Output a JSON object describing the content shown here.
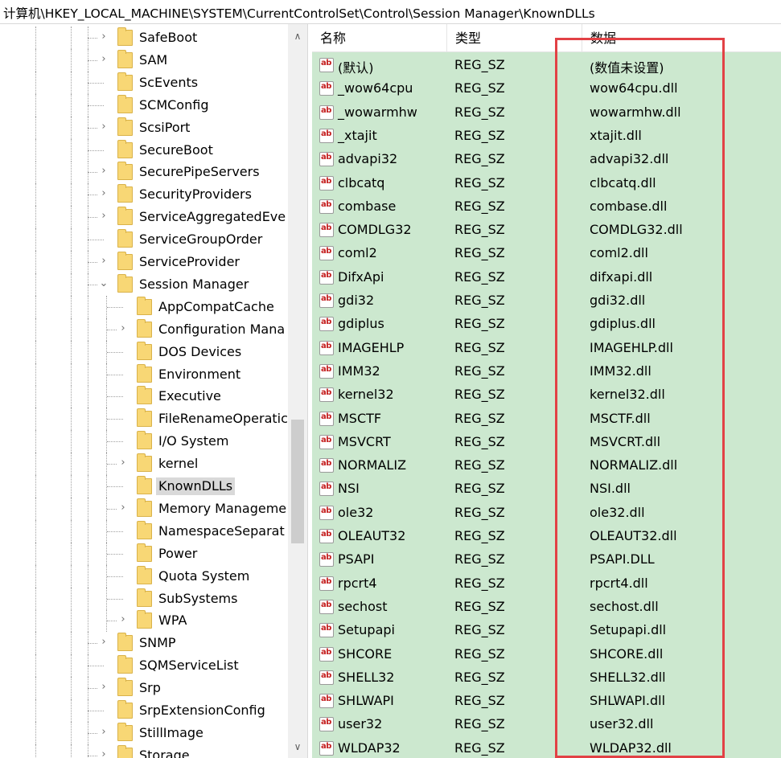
{
  "address_path": "计算机\\HKEY_LOCAL_MACHINE\\SYSTEM\\CurrentControlSet\\Control\\Session Manager\\KnownDLLs",
  "tree": [
    {
      "label": "SafeBoot",
      "level": 1,
      "expander": "›"
    },
    {
      "label": "SAM",
      "level": 1,
      "expander": "›"
    },
    {
      "label": "ScEvents",
      "level": 1,
      "expander": ""
    },
    {
      "label": "SCMConfig",
      "level": 1,
      "expander": ""
    },
    {
      "label": "ScsiPort",
      "level": 1,
      "expander": "›"
    },
    {
      "label": "SecureBoot",
      "level": 1,
      "expander": ""
    },
    {
      "label": "SecurePipeServers",
      "level": 1,
      "expander": "›"
    },
    {
      "label": "SecurityProviders",
      "level": 1,
      "expander": "›"
    },
    {
      "label": "ServiceAggregatedEve",
      "level": 1,
      "expander": "›"
    },
    {
      "label": "ServiceGroupOrder",
      "level": 1,
      "expander": ""
    },
    {
      "label": "ServiceProvider",
      "level": 1,
      "expander": "›"
    },
    {
      "label": "Session Manager",
      "level": 1,
      "expander": "⌄"
    },
    {
      "label": "AppCompatCache",
      "level": 2,
      "expander": ""
    },
    {
      "label": "Configuration Mana",
      "level": 2,
      "expander": "›"
    },
    {
      "label": "DOS Devices",
      "level": 2,
      "expander": ""
    },
    {
      "label": "Environment",
      "level": 2,
      "expander": ""
    },
    {
      "label": "Executive",
      "level": 2,
      "expander": ""
    },
    {
      "label": "FileRenameOperatic",
      "level": 2,
      "expander": ""
    },
    {
      "label": "I/O System",
      "level": 2,
      "expander": ""
    },
    {
      "label": "kernel",
      "level": 2,
      "expander": "›"
    },
    {
      "label": "KnownDLLs",
      "level": 2,
      "expander": "",
      "selected": true
    },
    {
      "label": "Memory Manageme",
      "level": 2,
      "expander": "›"
    },
    {
      "label": "NamespaceSeparat",
      "level": 2,
      "expander": ""
    },
    {
      "label": "Power",
      "level": 2,
      "expander": ""
    },
    {
      "label": "Quota System",
      "level": 2,
      "expander": ""
    },
    {
      "label": "SubSystems",
      "level": 2,
      "expander": ""
    },
    {
      "label": "WPA",
      "level": 2,
      "expander": "›"
    },
    {
      "label": "SNMP",
      "level": 1,
      "expander": "›"
    },
    {
      "label": "SQMServiceList",
      "level": 1,
      "expander": ""
    },
    {
      "label": "Srp",
      "level": 1,
      "expander": "›"
    },
    {
      "label": "SrpExtensionConfig",
      "level": 1,
      "expander": ""
    },
    {
      "label": "StillImage",
      "level": 1,
      "expander": "›"
    },
    {
      "label": "Storage",
      "level": 1,
      "expander": "›"
    }
  ],
  "tree_scroll": {
    "up": "∧",
    "down": "∨"
  },
  "columns": {
    "name": "名称",
    "type": "类型",
    "data": "数据"
  },
  "value_icon_text": "ab",
  "values": [
    {
      "name": "(默认)",
      "type": "REG_SZ",
      "data": "(数值未设置)"
    },
    {
      "name": "_wow64cpu",
      "type": "REG_SZ",
      "data": "wow64cpu.dll"
    },
    {
      "name": "_wowarmhw",
      "type": "REG_SZ",
      "data": "wowarmhw.dll"
    },
    {
      "name": "_xtajit",
      "type": "REG_SZ",
      "data": "xtajit.dll"
    },
    {
      "name": "advapi32",
      "type": "REG_SZ",
      "data": "advapi32.dll"
    },
    {
      "name": "clbcatq",
      "type": "REG_SZ",
      "data": "clbcatq.dll"
    },
    {
      "name": "combase",
      "type": "REG_SZ",
      "data": "combase.dll"
    },
    {
      "name": "COMDLG32",
      "type": "REG_SZ",
      "data": "COMDLG32.dll"
    },
    {
      "name": "coml2",
      "type": "REG_SZ",
      "data": "coml2.dll"
    },
    {
      "name": "DifxApi",
      "type": "REG_SZ",
      "data": "difxapi.dll"
    },
    {
      "name": "gdi32",
      "type": "REG_SZ",
      "data": "gdi32.dll"
    },
    {
      "name": "gdiplus",
      "type": "REG_SZ",
      "data": "gdiplus.dll"
    },
    {
      "name": "IMAGEHLP",
      "type": "REG_SZ",
      "data": "IMAGEHLP.dll"
    },
    {
      "name": "IMM32",
      "type": "REG_SZ",
      "data": "IMM32.dll"
    },
    {
      "name": "kernel32",
      "type": "REG_SZ",
      "data": "kernel32.dll"
    },
    {
      "name": "MSCTF",
      "type": "REG_SZ",
      "data": "MSCTF.dll"
    },
    {
      "name": "MSVCRT",
      "type": "REG_SZ",
      "data": "MSVCRT.dll"
    },
    {
      "name": "NORMALIZ",
      "type": "REG_SZ",
      "data": "NORMALIZ.dll"
    },
    {
      "name": "NSI",
      "type": "REG_SZ",
      "data": "NSI.dll"
    },
    {
      "name": "ole32",
      "type": "REG_SZ",
      "data": "ole32.dll"
    },
    {
      "name": "OLEAUT32",
      "type": "REG_SZ",
      "data": "OLEAUT32.dll"
    },
    {
      "name": "PSAPI",
      "type": "REG_SZ",
      "data": "PSAPI.DLL"
    },
    {
      "name": "rpcrt4",
      "type": "REG_SZ",
      "data": "rpcrt4.dll"
    },
    {
      "name": "sechost",
      "type": "REG_SZ",
      "data": "sechost.dll"
    },
    {
      "name": "Setupapi",
      "type": "REG_SZ",
      "data": "Setupapi.dll"
    },
    {
      "name": "SHCORE",
      "type": "REG_SZ",
      "data": "SHCORE.dll"
    },
    {
      "name": "SHELL32",
      "type": "REG_SZ",
      "data": "SHELL32.dll"
    },
    {
      "name": "SHLWAPI",
      "type": "REG_SZ",
      "data": "SHLWAPI.dll"
    },
    {
      "name": "user32",
      "type": "REG_SZ",
      "data": "user32.dll"
    },
    {
      "name": "WLDAP32",
      "type": "REG_SZ",
      "data": "WLDAP32.dll"
    }
  ],
  "colors": {
    "list_background": "#cce8cf",
    "highlight_box": "#e24145",
    "folder": "#f8d775",
    "selected_row": "#d9d9d9"
  }
}
